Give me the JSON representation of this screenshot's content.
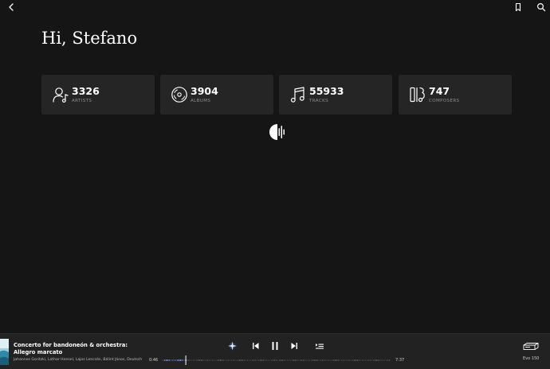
{
  "header": {
    "back_icon": "chevron-left-icon",
    "bookmark_icon": "bookmark-icon",
    "search_icon": "search-icon"
  },
  "greeting": "Hi, Stefano",
  "stats": [
    {
      "value": "3326",
      "label": "ARTISTS",
      "icon": "artist-icon"
    },
    {
      "value": "3904",
      "label": "ALBUMS",
      "icon": "album-icon"
    },
    {
      "value": "55933",
      "label": "TRACKS",
      "icon": "music-note-icon"
    },
    {
      "value": "747",
      "label": "COMPOSERS",
      "icon": "composer-icon"
    }
  ],
  "loading_icon": "loading-waveform-icon",
  "player": {
    "title": "Concerto for bandoneón & orchestra: Allegro marcato",
    "artists": "Johannes Goritzki, Lothar Hensel, Lajos Lencsés, Bálint János, Deutsche Kammerakademie Neuss",
    "elapsed": "0:46",
    "duration": "7:37",
    "progress": 0.1,
    "device": "Evo 150",
    "controls": [
      "radiance-icon",
      "previous-icon",
      "pause-icon",
      "next-icon",
      "queue-icon"
    ],
    "device_icon": "streamer-device-icon",
    "accent_color": "#8aa6ff"
  }
}
